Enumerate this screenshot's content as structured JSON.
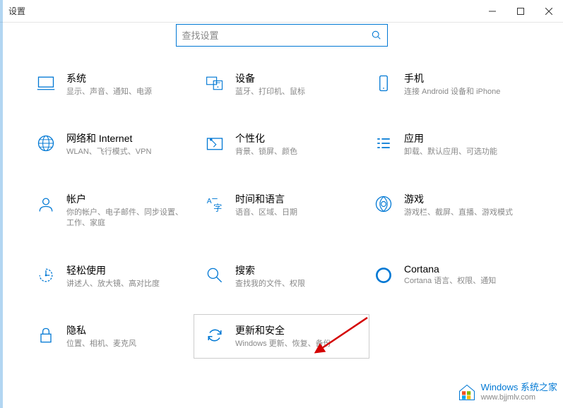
{
  "window": {
    "title": "设置"
  },
  "search": {
    "placeholder": "查找设置"
  },
  "categories": [
    {
      "id": "system",
      "title": "系统",
      "desc": "显示、声音、通知、电源"
    },
    {
      "id": "devices",
      "title": "设备",
      "desc": "蓝牙、打印机、鼠标"
    },
    {
      "id": "phone",
      "title": "手机",
      "desc": "连接 Android 设备和 iPhone"
    },
    {
      "id": "network",
      "title": "网络和 Internet",
      "desc": "WLAN、飞行模式、VPN"
    },
    {
      "id": "personalization",
      "title": "个性化",
      "desc": "背景、锁屏、颜色"
    },
    {
      "id": "apps",
      "title": "应用",
      "desc": "卸载、默认应用、可选功能"
    },
    {
      "id": "accounts",
      "title": "帐户",
      "desc": "你的帐户、电子邮件、同步设置、工作、家庭"
    },
    {
      "id": "time-language",
      "title": "时间和语言",
      "desc": "语音、区域、日期"
    },
    {
      "id": "gaming",
      "title": "游戏",
      "desc": "游戏栏、截屏、直播、游戏模式"
    },
    {
      "id": "ease-of-access",
      "title": "轻松使用",
      "desc": "讲述人、放大镜、高对比度"
    },
    {
      "id": "search-cat",
      "title": "搜索",
      "desc": "查找我的文件、权限"
    },
    {
      "id": "cortana",
      "title": "Cortana",
      "desc": "Cortana 语言、权限、通知"
    },
    {
      "id": "privacy",
      "title": "隐私",
      "desc": "位置、相机、麦克风"
    },
    {
      "id": "update-security",
      "title": "更新和安全",
      "desc": "Windows 更新、恢复、备份"
    }
  ],
  "watermark": {
    "line1": "Windows 系统之家",
    "line2": "www.bjjmlv.com"
  }
}
